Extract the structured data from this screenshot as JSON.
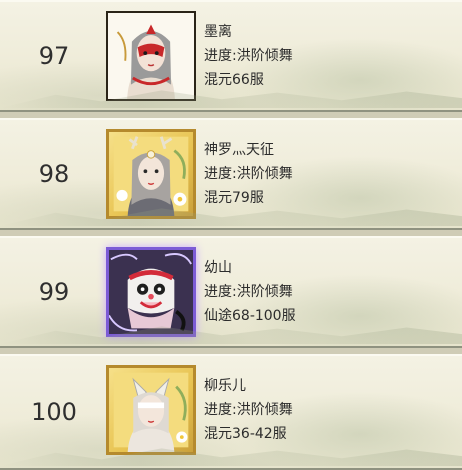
{
  "rows": [
    {
      "rank": "97",
      "name": "墨离",
      "progress": "进度:洪阶倾舞",
      "server": "混元66服",
      "avatar_style": "plain-red-mask-portrait"
    },
    {
      "rank": "98",
      "name": "神罗灬天征",
      "progress": "进度:洪阶倾舞",
      "server": "混元79服",
      "avatar_style": "gold-frame-antler-portrait"
    },
    {
      "rank": "99",
      "name": "幼山",
      "progress": "进度:洪阶倾舞",
      "server": "仙途68-100服",
      "avatar_style": "purple-frame-lion-mask"
    },
    {
      "rank": "100",
      "name": "柳乐儿",
      "progress": "进度:洪阶倾舞",
      "server": "混元36-42服",
      "avatar_style": "gold-frame-fox-portrait"
    }
  ]
}
